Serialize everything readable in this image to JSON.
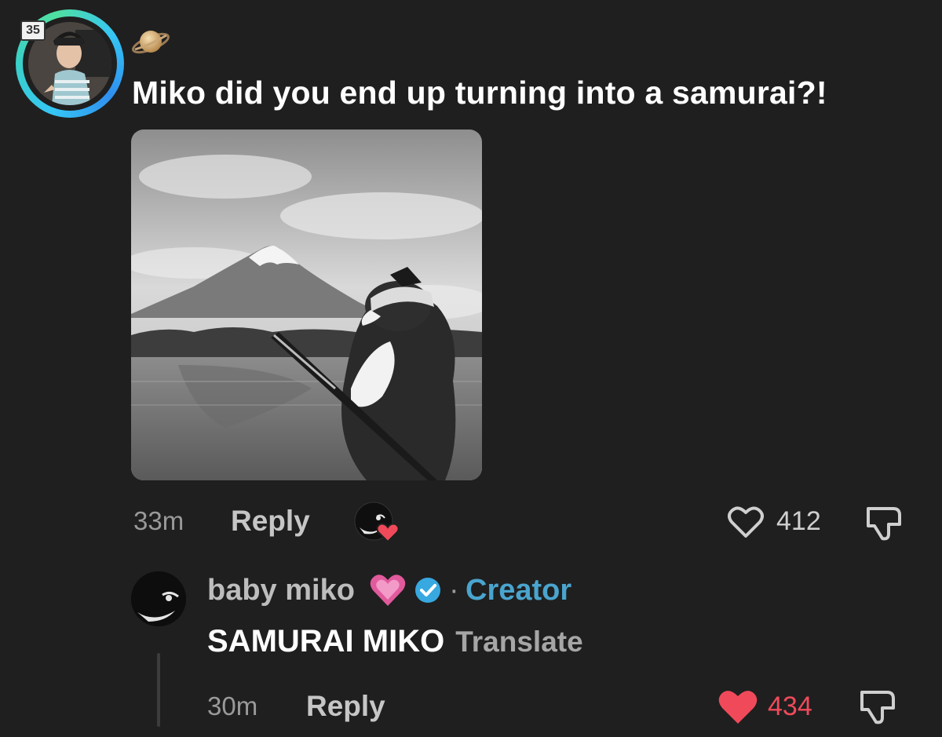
{
  "comment": {
    "text": "Miko did you end up turning into a samurai?!",
    "time": "33m",
    "reply_label": "Reply",
    "likes": "412",
    "avatar_badge": "35",
    "emoji": "saturn-planet-icon"
  },
  "reply": {
    "username": "baby miko",
    "separator": "·",
    "role": "Creator",
    "text": "SAMURAI MIKO",
    "translate_label": "Translate",
    "time": "30m",
    "reply_label": "Reply",
    "likes": "434",
    "liked": true
  },
  "colors": {
    "background": "#1f1f1f",
    "creator": "#4aa4ce",
    "liked_heart": "#f04a5a",
    "verified": "#38a8e0",
    "avatar_ring": "#36c6f4"
  },
  "icons": [
    "saturn-planet-icon",
    "heart-outline-icon",
    "heart-filled-icon",
    "dislike-icon",
    "verified-badge-icon",
    "pink-heart-icon",
    "creator-liked-avatar-icon"
  ]
}
